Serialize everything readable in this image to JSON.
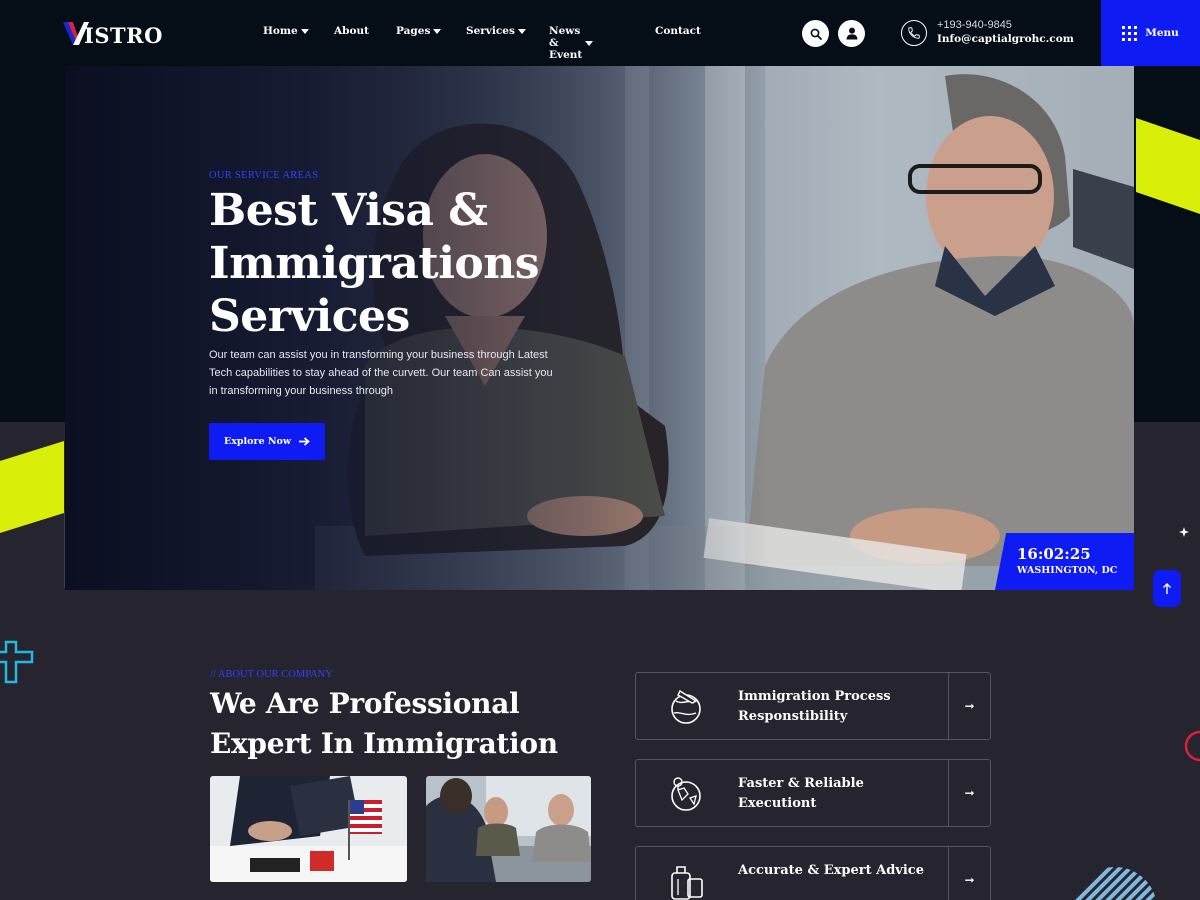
{
  "header": {
    "logo_text": "ISTRO",
    "nav": [
      {
        "label": "Home",
        "dropdown": true
      },
      {
        "label": "About",
        "dropdown": false
      },
      {
        "label": "Pages",
        "dropdown": true
      },
      {
        "label": "Services",
        "dropdown": true
      },
      {
        "label": "News & Event",
        "dropdown": true
      },
      {
        "label": "Contact",
        "dropdown": false
      }
    ],
    "phone": "+193-940-9845",
    "email": "Info@captialgrohc.com",
    "menu_label": "Menu"
  },
  "hero": {
    "tag": "OUR SERVICE AREAS",
    "title": "Best Visa & Immigrations Services",
    "description": "Our team can assist you in transforming your business through Latest Tech capabilities to stay ahead of the curvett. Our team Can assist you in transforming your business through",
    "cta_label": "Explore Now",
    "clock_time": "16:02:25",
    "clock_city": "WASHINGTON, DC"
  },
  "about": {
    "tag": "// ABOUT OUR COMPANY",
    "title": "We Are Professional Expert In Immigration",
    "features": [
      {
        "label": "Immigration Process Responstibility",
        "icon": "passport-globe-icon"
      },
      {
        "label": "Faster & Reliable Executiont",
        "icon": "world-map-icon"
      },
      {
        "label": "Accurate & Expert Advice",
        "icon": "luggage-icon"
      }
    ]
  },
  "colors": {
    "accent": "#0f1bf3",
    "lime": "#d9ef0a",
    "background": "#25242f",
    "header_bg": "#050d16"
  }
}
